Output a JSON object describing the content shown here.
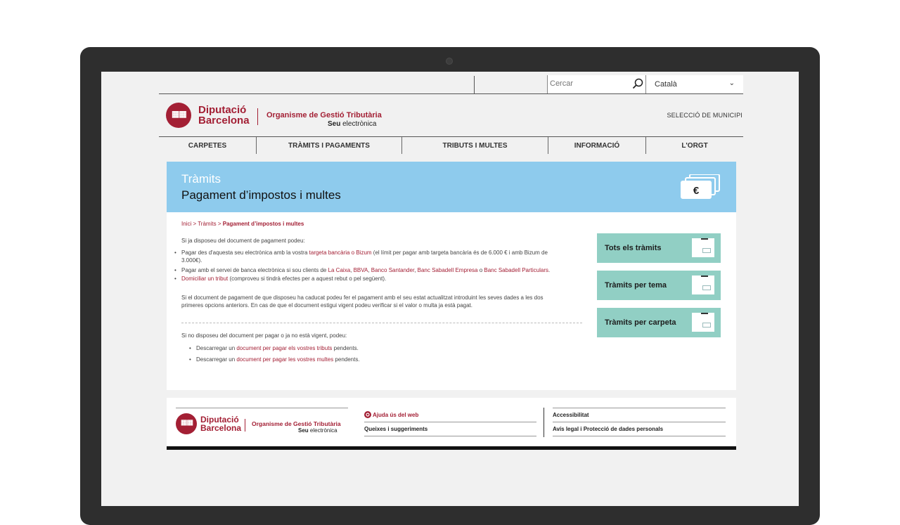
{
  "search": {
    "placeholder": "Cercar"
  },
  "language": {
    "selected": "Català"
  },
  "header": {
    "brand_line1": "Diputació",
    "brand_line2": "Barcelona",
    "org_name": "Organisme de Gestió Tributària",
    "seu_bold": "Seu",
    "seu_rest": " electrònica",
    "municipi_link": "SELECCIÓ DE MUNICIPI"
  },
  "nav": {
    "items": [
      {
        "label": "CARPETES"
      },
      {
        "label": "TRÀMITS I PAGAMENTS"
      },
      {
        "label": "TRIBUTS I MULTES"
      },
      {
        "label": "INFORMACIÓ"
      },
      {
        "label": "L'ORGT"
      }
    ]
  },
  "banner": {
    "kicker": "Tràmits",
    "title": "Pagament d’impostos i multes",
    "icon_symbol": "€"
  },
  "breadcrumb": {
    "home": "Inici",
    "sep": " > ",
    "level2": "Tràmits",
    "current": "Pagament d’impostos i multes"
  },
  "content": {
    "intro": "Si ja disposeu del document de pagament podeu:",
    "b1_pre": "Pagar des d'aquesta seu electrònica amb la vostra ",
    "b1_link": "targeta bancària o Bizum",
    "b1_post": " (el límit per pagar amb targeta bancària és de 6.000 € i amb Bizum de",
    "b1_post2": "3.000€).",
    "b2_pre": "Pagar amb el servei de banca electrònica si sou clients de ",
    "b2_links": [
      "La Caixa",
      "BBVA",
      "Banco Santander",
      "Banc Sabadell Empresa",
      "Banc Sabadell Particulars"
    ],
    "b2_or": " o ",
    "b3_link": "Domiciliar un tribut",
    "b3_post": " (comproveu si tindrà efectes per a aquest rebut o pel següent).",
    "para2_line1": "Si el document de pagament de que disposeu ha caducat podeu fer el pagament amb el seu estat actualitzat introduint les seves dades a les dos",
    "para2_line2": "primeres opcions anteriors. En cas de que el document estigui vigent podeu verificar si el valor o multa ja està pagat.",
    "para3": "Si no disposeu del document per pagar o ja no està vigent, podeu:",
    "s1_pre": "Descarregar un ",
    "s1_link": "document per pagar els vostres tributs",
    "s1_post": " pendents.",
    "s2_pre": "Descarregar un ",
    "s2_link": "document per pagar les vostres multes",
    "s2_post": " pendents."
  },
  "cards": [
    {
      "label": "Tots els tràmits"
    },
    {
      "label": "Tràmits per tema"
    },
    {
      "label": "Tràmits per carpeta"
    }
  ],
  "footer": {
    "help_link": "Ajuda ús del web",
    "complaints_link": "Queixes i suggeriments",
    "accessibility_link": "Accessibilitat",
    "legal_link": "Avís legal i Protecció de dades personals"
  },
  "colors": {
    "brand_red": "#a31f34",
    "banner_blue": "#8ecbed",
    "card_teal": "#91cfc4",
    "laptop_frame": "#2e2e2e"
  }
}
